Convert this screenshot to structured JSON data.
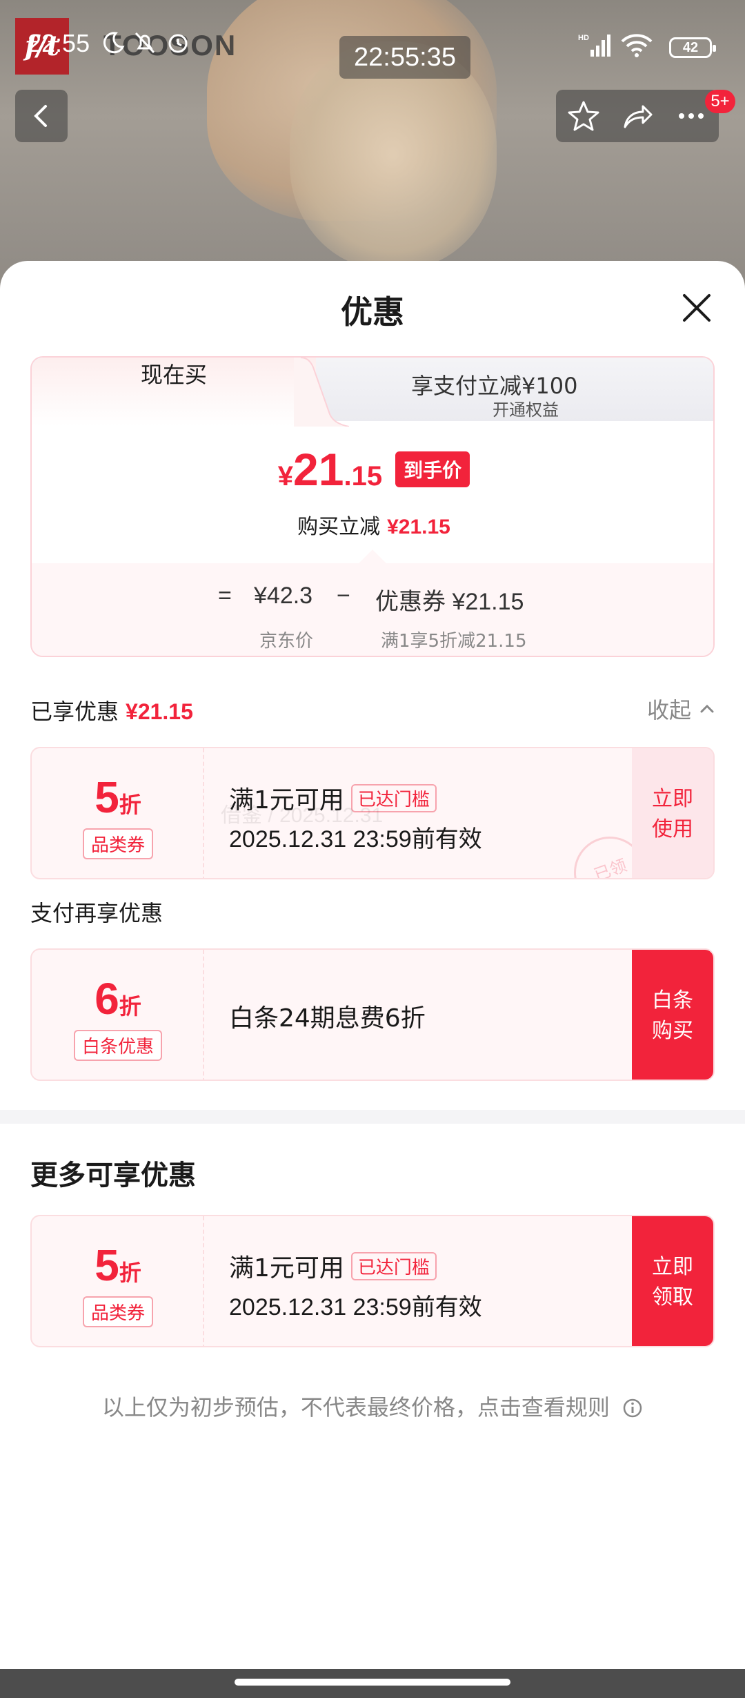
{
  "status_bar": {
    "time": "22:55",
    "center_time": "22:55:35",
    "battery": "42"
  },
  "background": {
    "logo_text": "f/t",
    "brand_text": "TOOSON"
  },
  "top_nav": {
    "badge": "5+"
  },
  "sheet": {
    "title": "优惠",
    "tabs": {
      "active": "现在买",
      "inactive": "享支付立减¥100",
      "inactive_sub": "开通权益"
    },
    "price": {
      "symbol": "¥",
      "integer": "21",
      "decimal": ".15",
      "tag": "到手价"
    },
    "instant": {
      "label": "购买立减",
      "value": "¥21.15"
    },
    "calc": {
      "eq": "=",
      "jd_price": "¥42.3",
      "minus": "−",
      "coupon": "优惠券 ¥21.15",
      "jd_label": "京东价",
      "coupon_label": "满1享5折减21.15"
    },
    "enjoyed": {
      "label": "已享优惠",
      "value": "¥21.15",
      "collapse": "收起"
    },
    "coupon1": {
      "discount": "5",
      "unit": "折",
      "category": "品类券",
      "line1": "满1元可用",
      "threshold": "已达门槛",
      "line2": "2025.12.31 23:59前有效",
      "action": "立即使用",
      "stamp": "已领",
      "watermark": "借鉴 / 2025.12.31"
    },
    "pay_more_label": "支付再享优惠",
    "coupon2": {
      "discount": "6",
      "unit": "折",
      "category": "白条优惠",
      "line1": "白条24期息费6折",
      "action": "白条购买"
    },
    "more_title": "更多可享优惠",
    "coupon3": {
      "discount": "5",
      "unit": "折",
      "category": "品类券",
      "line1": "满1元可用",
      "threshold": "已达门槛",
      "line2": "2025.12.31 23:59前有效",
      "action": "立即领取"
    },
    "disclaimer": "以上仅为初步预估，不代表最终价格，点击查看规则"
  },
  "colors": {
    "accent": "#f2233b",
    "coupon_bg": "#fff6f7"
  },
  "icons": [
    "back-arrow-icon",
    "star-icon",
    "share-icon",
    "more-icon",
    "close-icon",
    "chevron-up-icon",
    "info-icon"
  ]
}
